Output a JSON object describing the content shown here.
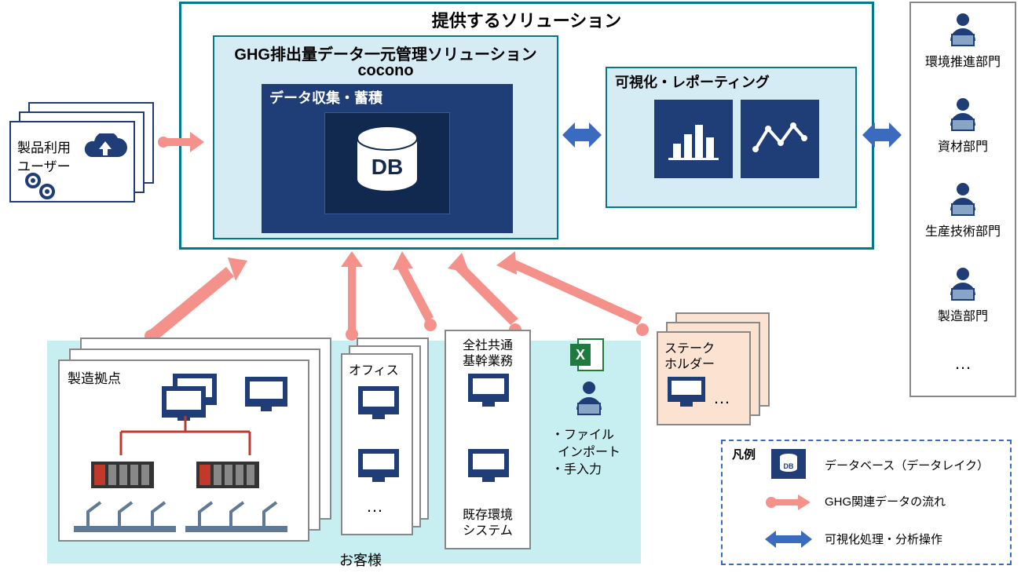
{
  "colors": {
    "navy": "#1f3e78",
    "teal": "#007a8a",
    "lightblue": "#d6ecf5",
    "palecyan": "#c7eff2",
    "peach": "#fbe2d1",
    "salmon": "#f4918a",
    "blue": "#3b6bbf"
  },
  "main": {
    "title": "提供するソリューション",
    "ghg_title_1": "GHG排出量データ一元管理ソリューション",
    "ghg_title_2": "cocono",
    "data_collect": "データ収集・蓄積",
    "db_label": "DB",
    "visualize": "可視化・レポーティング"
  },
  "left": {
    "users_1": "製品利用",
    "users_2": "ユーザー"
  },
  "bottom": {
    "customer": "お客様",
    "mfg_site": "製造拠点",
    "office": "オフィス",
    "erp_1": "全社共通",
    "erp_2": "基幹業務",
    "env_sys_1": "既存環境",
    "env_sys_2": "システム",
    "file_1": "・ファイル",
    "file_2": "インポート",
    "file_3": "・手入力",
    "stake_1": "ステーク",
    "stake_2": "ホルダー",
    "ellipsis": "…"
  },
  "right": {
    "dept1": "環境推進部門",
    "dept2": "資材部門",
    "dept3": "生産技術部門",
    "dept4": "製造部門",
    "ellipsis": "…"
  },
  "legend": {
    "title": "凡例",
    "db_small": "DB",
    "db": "データベース（データレイク）",
    "flow": "GHG関連データの流れ",
    "viz": "可視化処理・分析操作"
  }
}
